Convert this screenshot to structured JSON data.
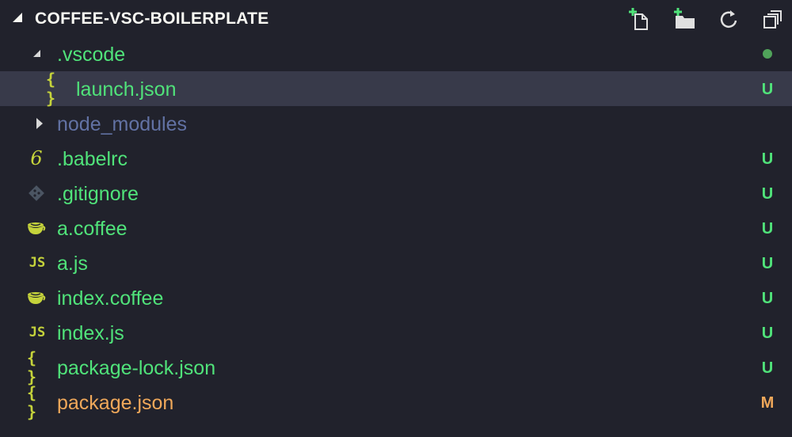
{
  "header": {
    "title": "COFFEE-VSC-BOILERPLATE",
    "actions": [
      {
        "name": "new-file-icon",
        "label": "New File"
      },
      {
        "name": "new-folder-icon",
        "label": "New Folder"
      },
      {
        "name": "refresh-icon",
        "label": "Refresh"
      },
      {
        "name": "collapse-all-icon",
        "label": "Collapse All"
      }
    ]
  },
  "colors": {
    "background": "#21222c",
    "selected": "#383a4a",
    "untracked": "#50e37a",
    "modified": "#f0a85a",
    "ignored": "#6272a4",
    "icon_yellow": "#c5d33b"
  },
  "tree": {
    "items": [
      {
        "label": ".vscode",
        "kind": "folder-open",
        "badge": "",
        "status": "dot"
      },
      {
        "label": "launch.json",
        "kind": "json",
        "badge": "U",
        "status": "untracked"
      },
      {
        "label": "node_modules",
        "kind": "folder-closed",
        "badge": "",
        "status": "ignored"
      },
      {
        "label": ".babelrc",
        "kind": "babel",
        "badge": "U",
        "status": "untracked"
      },
      {
        "label": ".gitignore",
        "kind": "git",
        "badge": "U",
        "status": "untracked"
      },
      {
        "label": "a.coffee",
        "kind": "coffee",
        "badge": "U",
        "status": "untracked"
      },
      {
        "label": "a.js",
        "kind": "js",
        "badge": "U",
        "status": "untracked"
      },
      {
        "label": "index.coffee",
        "kind": "coffee",
        "badge": "U",
        "status": "untracked"
      },
      {
        "label": "index.js",
        "kind": "js",
        "badge": "U",
        "status": "untracked"
      },
      {
        "label": "package-lock.json",
        "kind": "json",
        "badge": "U",
        "status": "untracked"
      },
      {
        "label": "package.json",
        "kind": "json",
        "badge": "M",
        "status": "modified"
      }
    ]
  }
}
